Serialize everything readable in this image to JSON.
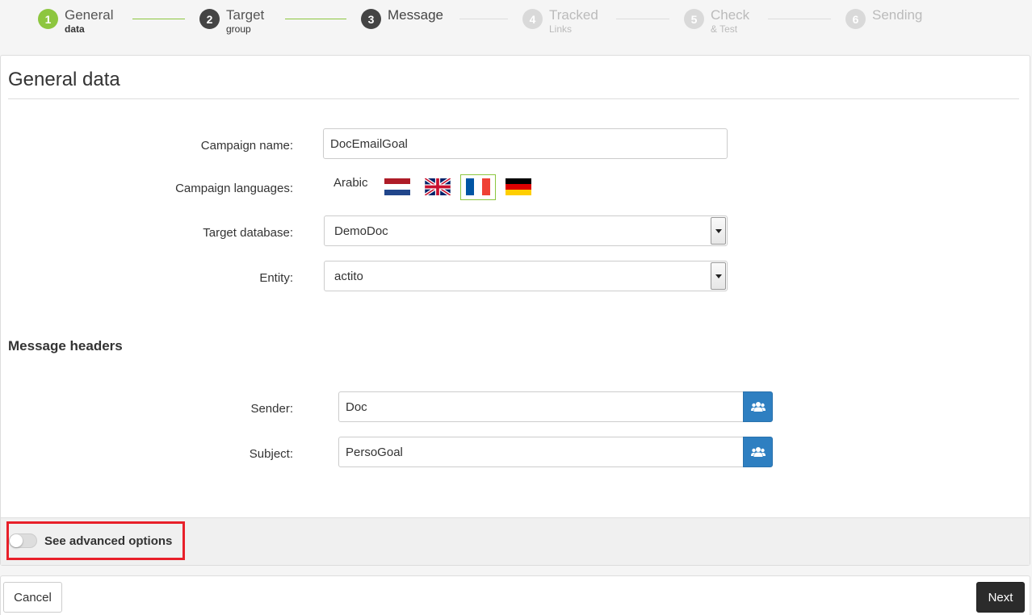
{
  "stepper": {
    "steps": [
      {
        "num": "1",
        "line1": "General",
        "line2": "data",
        "state": "done"
      },
      {
        "num": "2",
        "line1": "Target",
        "line2": "group",
        "state": "done"
      },
      {
        "num": "3",
        "line1": "Message",
        "line2": "",
        "state": "current"
      },
      {
        "num": "4",
        "line1": "Tracked",
        "line2": "Links",
        "state": "future"
      },
      {
        "num": "5",
        "line1": "Check",
        "line2": "& Test",
        "state": "future"
      },
      {
        "num": "6",
        "line1": "Sending",
        "line2": "",
        "state": "future"
      }
    ]
  },
  "panel": {
    "title": "General data"
  },
  "form": {
    "campaign_name_label": "Campaign name:",
    "campaign_name_value": "DocEmailGoal",
    "languages_label": "Campaign languages:",
    "languages_text": "Arabic",
    "languages": [
      "dutch-flag",
      "uk-flag",
      "french-flag",
      "german-flag"
    ],
    "selected_language": "french-flag",
    "target_db_label": "Target database:",
    "target_db_value": "DemoDoc",
    "entity_label": "Entity:",
    "entity_value": "actito"
  },
  "headers": {
    "title": "Message headers",
    "sender_label": "Sender:",
    "sender_value": "Doc",
    "subject_label": "Subject:",
    "subject_value": "PersoGoal"
  },
  "advanced": {
    "label": "See advanced options",
    "enabled": false
  },
  "footer": {
    "cancel_label": "Cancel",
    "next_label": "Next"
  },
  "colors": {
    "done": "#8dc63f",
    "current": "#444444",
    "future": "#d9d9d9",
    "primary_button": "#2e7fc1",
    "highlight": "#e8202a"
  }
}
